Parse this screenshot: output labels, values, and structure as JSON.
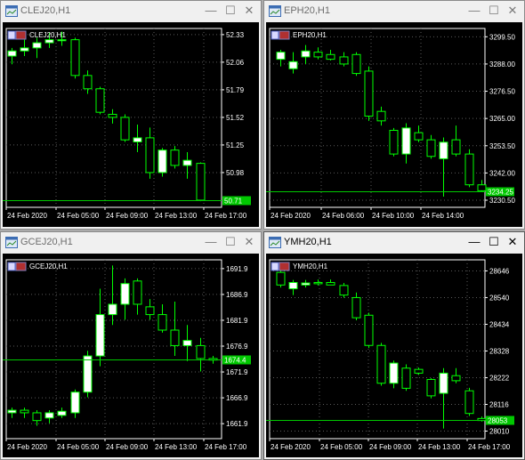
{
  "windows": [
    {
      "title": "CLEJ20,H1",
      "symbol_label": "CLEJ20,H1",
      "active": false,
      "controls": {
        "minimize": "—",
        "maximize": "☐",
        "close": "✕"
      },
      "yticks": [
        "52.33",
        "52.06",
        "51.79",
        "51.52",
        "51.25",
        "50.98"
      ],
      "xticks": [
        "24 Feb 2020",
        "24 Feb 05:00",
        "24 Feb 09:00",
        "24 Feb 13:00",
        "24 Feb 17:00"
      ],
      "current_price": "50.71",
      "chart_data": {
        "type": "candlestick",
        "ylim": [
          50.64,
          52.39
        ],
        "price_line": 50.71,
        "candles": [
          {
            "o": 52.12,
            "h": 52.2,
            "l": 52.04,
            "c": 52.17
          },
          {
            "o": 52.17,
            "h": 52.28,
            "l": 52.12,
            "c": 52.2
          },
          {
            "o": 52.2,
            "h": 52.3,
            "l": 52.1,
            "c": 52.25
          },
          {
            "o": 52.25,
            "h": 52.35,
            "l": 52.2,
            "c": 52.28
          },
          {
            "o": 52.27,
            "h": 52.36,
            "l": 52.22,
            "c": 52.28
          },
          {
            "o": 52.28,
            "h": 52.3,
            "l": 51.9,
            "c": 51.93
          },
          {
            "o": 51.93,
            "h": 51.98,
            "l": 51.75,
            "c": 51.8
          },
          {
            "o": 51.8,
            "h": 51.82,
            "l": 51.55,
            "c": 51.57
          },
          {
            "o": 51.55,
            "h": 51.6,
            "l": 51.46,
            "c": 51.52
          },
          {
            "o": 51.52,
            "h": 51.55,
            "l": 51.28,
            "c": 51.3
          },
          {
            "o": 51.28,
            "h": 51.45,
            "l": 51.18,
            "c": 51.32
          },
          {
            "o": 51.32,
            "h": 51.42,
            "l": 50.92,
            "c": 50.98
          },
          {
            "o": 50.98,
            "h": 51.22,
            "l": 50.94,
            "c": 51.2
          },
          {
            "o": 51.2,
            "h": 51.24,
            "l": 51.02,
            "c": 51.05
          },
          {
            "o": 51.05,
            "h": 51.18,
            "l": 50.92,
            "c": 51.1
          },
          {
            "o": 51.07,
            "h": 51.08,
            "l": 50.7,
            "c": 50.71
          }
        ]
      }
    },
    {
      "title": "EPH20,H1",
      "symbol_label": "EPH20,H1",
      "active": false,
      "controls": {
        "minimize": "—",
        "maximize": "☐",
        "close": "✕"
      },
      "yticks": [
        "3299.50",
        "3288.00",
        "3276.50",
        "3265.00",
        "3253.50",
        "3242.00",
        "3230.50"
      ],
      "xticks": [
        "24 Feb 2020",
        "24 Feb 06:00",
        "24 Feb 10:00",
        "24 Feb 14:00"
      ],
      "current_price": "3234.25",
      "chart_data": {
        "type": "candlestick",
        "ylim": [
          3227.5,
          3303.0
        ],
        "price_line": 3234.25,
        "candles": [
          {
            "o": 3290.0,
            "h": 3294.0,
            "l": 3287.0,
            "c": 3293.0
          },
          {
            "o": 3286.0,
            "h": 3293.0,
            "l": 3284.0,
            "c": 3289.0
          },
          {
            "o": 3291.0,
            "h": 3296.0,
            "l": 3288.0,
            "c": 3293.5
          },
          {
            "o": 3293.0,
            "h": 3295.0,
            "l": 3290.0,
            "c": 3291.0
          },
          {
            "o": 3292.0,
            "h": 3294.0,
            "l": 3289.5,
            "c": 3290.0
          },
          {
            "o": 3291.0,
            "h": 3293.0,
            "l": 3287.0,
            "c": 3288.0
          },
          {
            "o": 3292.0,
            "h": 3293.0,
            "l": 3283.0,
            "c": 3284.0
          },
          {
            "o": 3285.0,
            "h": 3287.0,
            "l": 3264.0,
            "c": 3266.0
          },
          {
            "o": 3268.0,
            "h": 3270.0,
            "l": 3262.0,
            "c": 3264.0
          },
          {
            "o": 3260.0,
            "h": 3261.0,
            "l": 3249.0,
            "c": 3250.0
          },
          {
            "o": 3250.0,
            "h": 3263.0,
            "l": 3246.0,
            "c": 3261.0
          },
          {
            "o": 3259.0,
            "h": 3262.0,
            "l": 3255.0,
            "c": 3256.0
          },
          {
            "o": 3256.0,
            "h": 3258.0,
            "l": 3248.0,
            "c": 3249.0
          },
          {
            "o": 3248.0,
            "h": 3257.0,
            "l": 3232.0,
            "c": 3255.0
          },
          {
            "o": 3256.0,
            "h": 3262.0,
            "l": 3249.0,
            "c": 3250.0
          },
          {
            "o": 3250.0,
            "h": 3252.0,
            "l": 3236.0,
            "c": 3237.0
          },
          {
            "o": 3237.0,
            "h": 3239.0,
            "l": 3234.0,
            "c": 3234.5
          }
        ]
      }
    },
    {
      "title": "GCEJ20,H1",
      "symbol_label": "GCEJ20,H1",
      "active": false,
      "controls": {
        "minimize": "—",
        "maximize": "☐",
        "close": "✕"
      },
      "yticks": [
        "1691.9",
        "1686.9",
        "1681.9",
        "1676.9",
        "1671.9",
        "1666.9",
        "1661.9"
      ],
      "xticks": [
        "24 Feb 2020",
        "24 Feb 05:00",
        "24 Feb 09:00",
        "24 Feb 13:00",
        "24 Feb 17:00"
      ],
      "current_price": "1674.4",
      "chart_data": {
        "type": "candlestick",
        "ylim": [
          1659.0,
          1693.6
        ],
        "price_line": 1674.4,
        "candles": [
          {
            "o": 1664.0,
            "h": 1665.0,
            "l": 1663.0,
            "c": 1664.5
          },
          {
            "o": 1664.5,
            "h": 1665.0,
            "l": 1663.0,
            "c": 1664.0
          },
          {
            "o": 1664.0,
            "h": 1664.5,
            "l": 1661.5,
            "c": 1662.5
          },
          {
            "o": 1663.0,
            "h": 1664.5,
            "l": 1662.0,
            "c": 1664.0
          },
          {
            "o": 1663.5,
            "h": 1665.0,
            "l": 1663.0,
            "c": 1664.3
          },
          {
            "o": 1664.0,
            "h": 1668.5,
            "l": 1663.0,
            "c": 1668.0
          },
          {
            "o": 1668.0,
            "h": 1676.0,
            "l": 1667.0,
            "c": 1675.0
          },
          {
            "o": 1675.0,
            "h": 1688.0,
            "l": 1673.0,
            "c": 1683.0
          },
          {
            "o": 1683.0,
            "h": 1692.5,
            "l": 1681.0,
            "c": 1685.0
          },
          {
            "o": 1685.0,
            "h": 1690.0,
            "l": 1682.0,
            "c": 1689.0
          },
          {
            "o": 1689.5,
            "h": 1690.0,
            "l": 1683.0,
            "c": 1685.0
          },
          {
            "o": 1684.5,
            "h": 1686.0,
            "l": 1682.0,
            "c": 1683.0
          },
          {
            "o": 1683.0,
            "h": 1685.0,
            "l": 1679.5,
            "c": 1680.0
          },
          {
            "o": 1680.0,
            "h": 1685.5,
            "l": 1675.0,
            "c": 1677.0
          },
          {
            "o": 1677.0,
            "h": 1681.0,
            "l": 1674.0,
            "c": 1678.0
          },
          {
            "o": 1677.0,
            "h": 1678.5,
            "l": 1672.0,
            "c": 1674.5
          },
          {
            "o": 1674.5,
            "h": 1675.0,
            "l": 1673.5,
            "c": 1674.2
          }
        ]
      }
    },
    {
      "title": "YMH20,H1",
      "symbol_label": "YMH20,H1",
      "active": true,
      "controls": {
        "minimize": "—",
        "maximize": "☐",
        "close": "✕"
      },
      "yticks": [
        "28646",
        "28540",
        "28434",
        "28328",
        "28222",
        "28116",
        "28010"
      ],
      "xticks": [
        "24 Feb 2020",
        "24 Feb 05:00",
        "24 Feb 09:00",
        "24 Feb 13:00",
        "24 Feb 17:00"
      ],
      "current_price": "28053",
      "chart_data": {
        "type": "candlestick",
        "ylim": [
          27980,
          28690
        ],
        "price_line": 28053,
        "candles": [
          {
            "o": 28640,
            "h": 28660,
            "l": 28580,
            "c": 28590
          },
          {
            "o": 28575,
            "h": 28610,
            "l": 28550,
            "c": 28600
          },
          {
            "o": 28590,
            "h": 28610,
            "l": 28580,
            "c": 28598
          },
          {
            "o": 28600,
            "h": 28612,
            "l": 28588,
            "c": 28595
          },
          {
            "o": 28600,
            "h": 28612,
            "l": 28590,
            "c": 28590
          },
          {
            "o": 28588,
            "h": 28598,
            "l": 28540,
            "c": 28550
          },
          {
            "o": 28540,
            "h": 28560,
            "l": 28450,
            "c": 28460
          },
          {
            "o": 28470,
            "h": 28480,
            "l": 28340,
            "c": 28350
          },
          {
            "o": 28350,
            "h": 28360,
            "l": 28190,
            "c": 28200
          },
          {
            "o": 28200,
            "h": 28290,
            "l": 28180,
            "c": 28280
          },
          {
            "o": 28260,
            "h": 28275,
            "l": 28170,
            "c": 28180
          },
          {
            "o": 28255,
            "h": 28262,
            "l": 28233,
            "c": 28240
          },
          {
            "o": 28215,
            "h": 28220,
            "l": 28140,
            "c": 28150
          },
          {
            "o": 28160,
            "h": 28260,
            "l": 28020,
            "c": 28240
          },
          {
            "o": 28230,
            "h": 28260,
            "l": 28200,
            "c": 28210
          },
          {
            "o": 28170,
            "h": 28182,
            "l": 28070,
            "c": 28080
          },
          {
            "o": 28060,
            "h": 28068,
            "l": 28048,
            "c": 28052
          }
        ]
      }
    }
  ],
  "colors": {
    "background": "#000000",
    "bull_body": "#ffffff",
    "candle_outline": "#00ff00",
    "grid": "#5a5a5a",
    "axis_text": "#ffffff",
    "price_line": "#00c800",
    "price_tag_bg": "#00c800"
  },
  "icons": {
    "window_icon": "chart-window-icon",
    "symbol_icon": "symbol-flag-icon"
  }
}
